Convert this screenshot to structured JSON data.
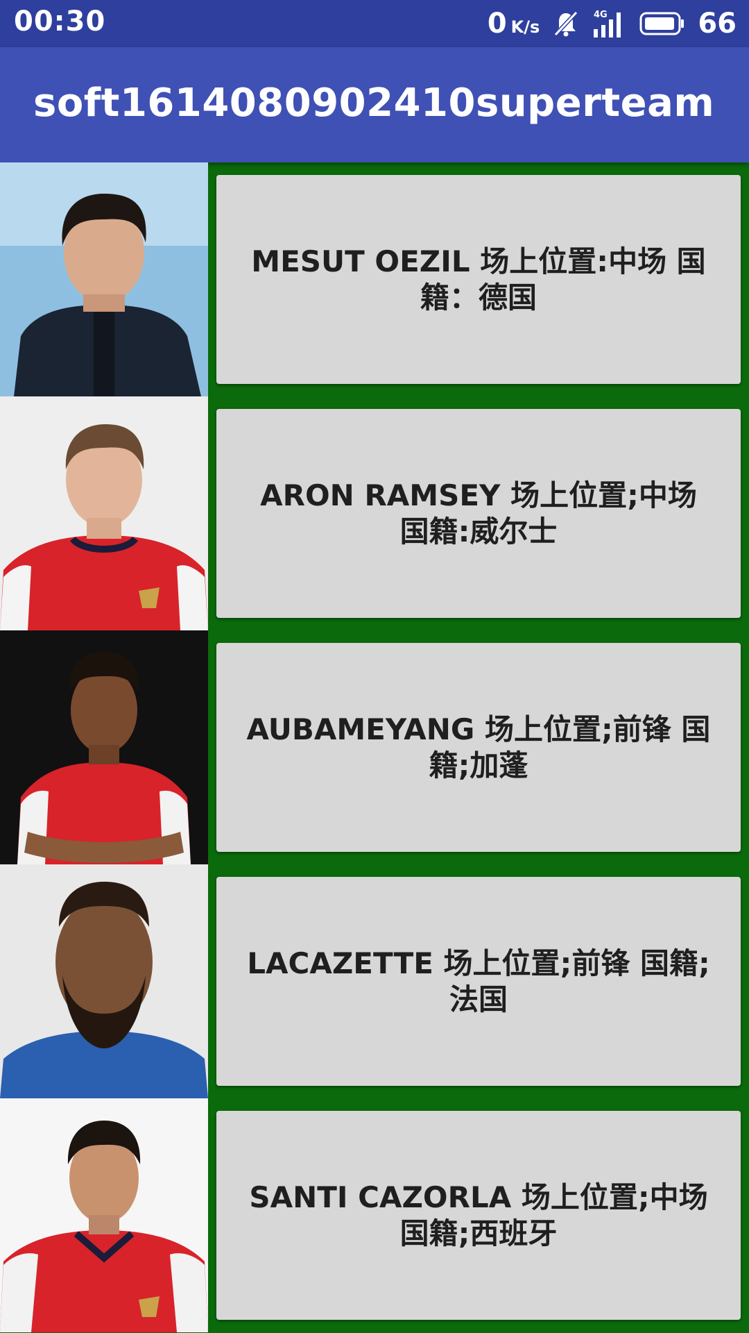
{
  "status_bar": {
    "time": "00:30",
    "net_speed": "0",
    "net_speed_unit": "K/s",
    "network_type": "4G",
    "battery_level": "66",
    "icons": [
      "mute-icon",
      "signal-icon",
      "battery-icon"
    ]
  },
  "app_bar": {
    "title": "soft1614080902410superteam",
    "color": "#3f51b5"
  },
  "list": {
    "background_color": "#0b6a0b",
    "items": [
      {
        "text": "MESUT OEZIL 场上位置:中场 国籍：德国",
        "photo": "player-photo-oezil"
      },
      {
        "text": "ARON RAMSEY 场上位置;中场 国籍:威尔士",
        "photo": "player-photo-ramsey"
      },
      {
        "text": "AUBAMEYANG 场上位置;前锋 国籍;加蓬",
        "photo": "player-photo-aubameyang"
      },
      {
        "text": "LACAZETTE 场上位置;前锋 国籍;法国",
        "photo": "player-photo-lacazette"
      },
      {
        "text": "SANTI CAZORLA 场上位置;中场 国籍;西班牙",
        "photo": "player-photo-cazorla"
      }
    ]
  }
}
